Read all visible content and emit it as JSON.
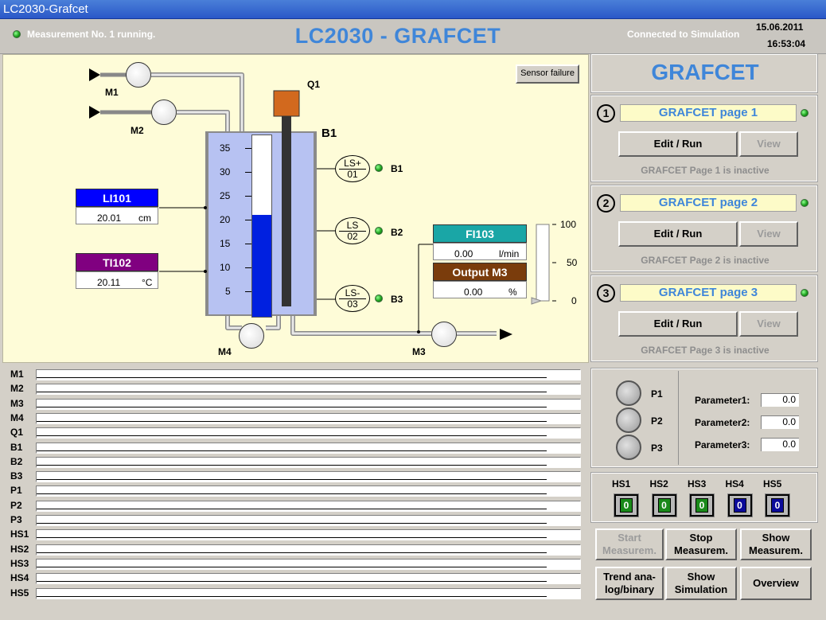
{
  "window": {
    "title": "LC2030-Grafcet"
  },
  "header": {
    "status": "Measurement No. 1 running.",
    "title": "LC2030 - GRAFCET",
    "connection": "Connected to Simulation",
    "date": "15.06.2011",
    "time": "16:53:04"
  },
  "process": {
    "sensor_failure": "Sensor failure",
    "labels": {
      "m1": "M1",
      "m2": "M2",
      "m3": "M3",
      "m4": "M4",
      "q1": "Q1",
      "b1_tank": "B1",
      "b1": "B1",
      "b2": "B2",
      "b3": "B3"
    },
    "sensors": [
      {
        "top": "LS+",
        "bottom": "01"
      },
      {
        "top": "LS",
        "bottom": "02"
      },
      {
        "top": "LS-",
        "bottom": "03"
      }
    ],
    "tank_scale": [
      "35",
      "30",
      "25",
      "20",
      "15",
      "10",
      "5"
    ],
    "level_fraction": 0.56,
    "li101": {
      "name": "LI101",
      "value": "20.01",
      "unit": "cm",
      "color": "#0000ff"
    },
    "ti102": {
      "name": "TI102",
      "value": "20.11",
      "unit": "°C",
      "color": "#800080"
    },
    "fi103": {
      "name": "FI103",
      "value": "0.00",
      "unit": "l/min",
      "color": "#1aa6a6"
    },
    "output_m3": {
      "name": "Output M3",
      "value": "0.00",
      "unit": "%",
      "color": "#7a3c0c"
    },
    "output_scale": [
      "100",
      "50",
      "0"
    ]
  },
  "signals": [
    "M1",
    "M2",
    "M3",
    "M4",
    "Q1",
    "B1",
    "B2",
    "B3",
    "P1",
    "P2",
    "P3",
    "HS1",
    "HS2",
    "HS3",
    "HS4",
    "HS5"
  ],
  "grafcet": {
    "title": "GRAFCET",
    "pages": [
      {
        "num": "1",
        "name": "GRAFCET page 1",
        "edit": "Edit / Run",
        "view": "View",
        "status": "GRAFCET Page 1 is inactive"
      },
      {
        "num": "2",
        "name": "GRAFCET page 2",
        "edit": "Edit / Run",
        "view": "View",
        "status": "GRAFCET Page 2 is inactive"
      },
      {
        "num": "3",
        "name": "GRAFCET page 3",
        "edit": "Edit / Run",
        "view": "View",
        "status": "GRAFCET Page 3 is inactive"
      }
    ]
  },
  "params": {
    "buttons": [
      "P1",
      "P2",
      "P3"
    ],
    "fields": [
      {
        "label": "Parameter1:",
        "value": "0.0"
      },
      {
        "label": "Parameter2:",
        "value": "0.0"
      },
      {
        "label": "Parameter3:",
        "value": "0.0"
      }
    ]
  },
  "hs": [
    {
      "label": "HS1",
      "value": "0",
      "color": "#1a8a1a"
    },
    {
      "label": "HS2",
      "value": "0",
      "color": "#1a8a1a"
    },
    {
      "label": "HS3",
      "value": "0",
      "color": "#1a8a1a"
    },
    {
      "label": "HS4",
      "value": "0",
      "color": "#0a0a9a"
    },
    {
      "label": "HS5",
      "value": "0",
      "color": "#0a0a9a"
    }
  ],
  "actions": {
    "start": [
      "Start",
      "Measurem."
    ],
    "stop": [
      "Stop",
      "Measurem."
    ],
    "show": [
      "Show",
      "Measurem."
    ],
    "trend": [
      "Trend ana-",
      "log/binary"
    ],
    "simulation": [
      "Show",
      "Simulation"
    ],
    "overview": "Overview"
  }
}
